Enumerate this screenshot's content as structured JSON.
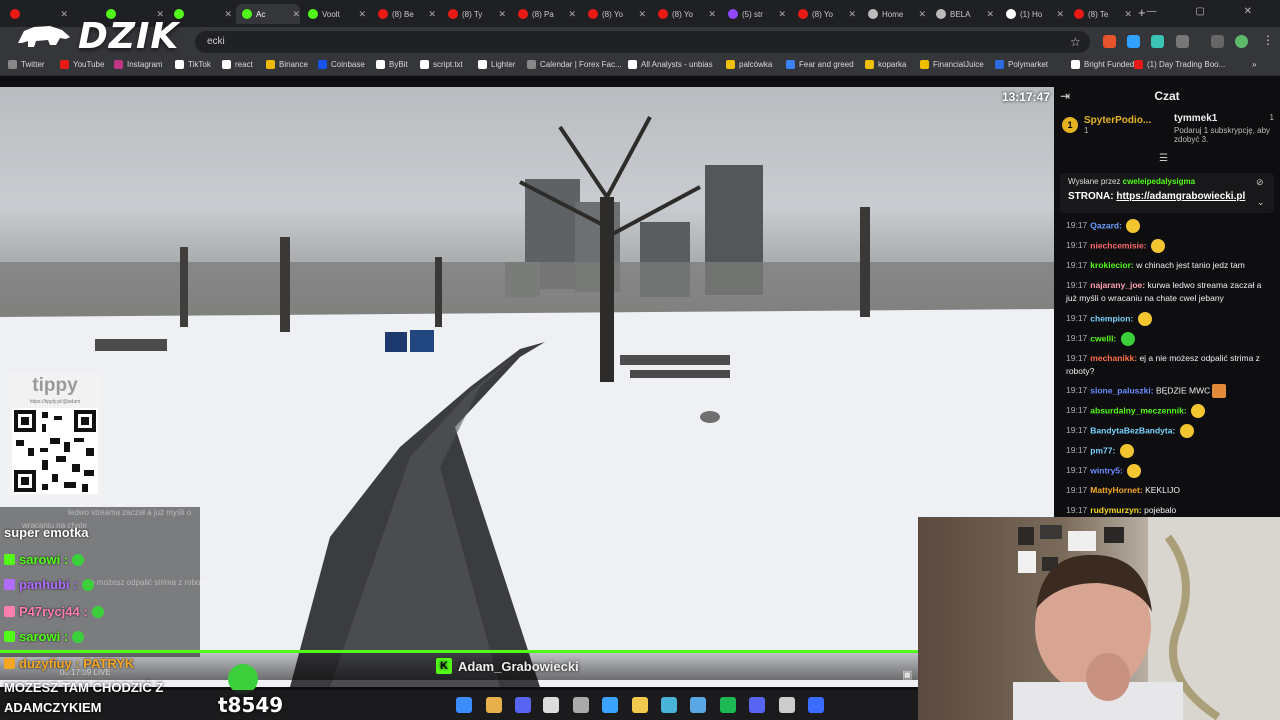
{
  "browser": {
    "tabs": [
      {
        "label": "",
        "color": "#e91916"
      },
      {
        "label": "",
        "color": "#53fc18"
      },
      {
        "label": "",
        "color": "#53fc18"
      },
      {
        "label": "Ac",
        "color": "#53fc18",
        "active": true
      },
      {
        "label": "Voolt",
        "color": "#53fc18"
      },
      {
        "label": "(8) Be",
        "color": "#e91916"
      },
      {
        "label": "(8) Ty",
        "color": "#e91916"
      },
      {
        "label": "(8) Pa",
        "color": "#e91916"
      },
      {
        "label": "(8) Yo",
        "color": "#e91916"
      },
      {
        "label": "(8) Yo",
        "color": "#e91916"
      },
      {
        "label": "(5) str",
        "color": "#9146ff"
      },
      {
        "label": "(8) Yo",
        "color": "#e91916"
      },
      {
        "label": "Home",
        "color": "#bbbbbb"
      },
      {
        "label": "BELA",
        "color": "#bbbbbb"
      },
      {
        "label": "(1) Ho",
        "color": "#ffffff"
      },
      {
        "label": "(8) Te",
        "color": "#e91916"
      }
    ],
    "new_tab": "+",
    "omnibox_text": "ecki",
    "bookmarks": [
      {
        "label": "Twitter",
        "color": "#888888"
      },
      {
        "label": "YouTube",
        "color": "#e91916"
      },
      {
        "label": "Instagram",
        "color": "#c13584"
      },
      {
        "label": "TikTok",
        "color": "#ffffff"
      },
      {
        "label": "react",
        "color": "#ffffff"
      },
      {
        "label": "Binance",
        "color": "#f0b90b"
      },
      {
        "label": "Coinbase",
        "color": "#1652f0"
      },
      {
        "label": "ByBit",
        "color": "#ffffff"
      },
      {
        "label": "script.txt",
        "color": "#ffffff"
      },
      {
        "label": "Lighter",
        "color": "#ffffff"
      },
      {
        "label": "Calendar | Forex Fac...",
        "color": "#888888"
      },
      {
        "label": "All Analysts - unbias",
        "color": "#ffffff"
      },
      {
        "label": "palcówka",
        "color": "#f0c000"
      },
      {
        "label": "Fear and greed",
        "color": "#3b82f6"
      },
      {
        "label": "koparka",
        "color": "#f0c000"
      },
      {
        "label": "FinancialJuice",
        "color": "#f0c000"
      },
      {
        "label": "Polymarket",
        "color": "#2d6cdf"
      },
      {
        "label": "Bright Funded",
        "color": "#ffffff"
      },
      {
        "label": "(1) Day Trading Boo...",
        "color": "#e91916"
      }
    ],
    "more": "»"
  },
  "logo": {
    "text": "DZIK"
  },
  "stream": {
    "clock": "13:17:47",
    "tippy": {
      "title": "tippy",
      "url": "https://tipply.pl/@adam"
    },
    "overlay_chat": [
      {
        "text": "super emotka",
        "color": "#ffffff"
      },
      {
        "text": "sarowi :",
        "color": "#53fc18"
      },
      {
        "text": "panhubi :",
        "color": "#b06cff"
      },
      {
        "text": "P47rycj44 :",
        "color": "#ff7fb0"
      },
      {
        "text": "sarowi :",
        "color": "#53fc18"
      },
      {
        "text": "duzyfiuy : PATRYK",
        "color": "#f5a623"
      }
    ],
    "ghost_lines": [
      "ledwo streama zaczał a już myśli o",
      "wracaniu na chate",
      "nie możesz odpalić strima z roboty?"
    ],
    "streamer_name": "Adam_Grabowiecki",
    "live_time": "00:17:09",
    "live_label": "LIVE",
    "marquee": "MOZESZ TAM CHODZIĆ Z ADAMCZYKIEM",
    "counter": "t8549"
  },
  "chat": {
    "title": "Czat",
    "leaderboard": [
      {
        "rank": "1",
        "name": "SpyterPodio...",
        "count": "1"
      },
      {
        "name": "tymmek1",
        "count": "1",
        "sub": "Podaruj 1 subskrypcję, aby zdobyć 3."
      }
    ],
    "pinned": {
      "by_label": "Wysłane przez",
      "by_user": "cweleipedalysigma",
      "text_prefix": "STRONA: ",
      "link": "https://adamgrabowiecki.pl"
    },
    "messages": [
      {
        "time": "19:17",
        "user": "Qazard:",
        "color": "#6aa0ff",
        "text": ""
      },
      {
        "time": "19:17",
        "user": "niechcemisie:",
        "color": "#ff6b6b",
        "text": ""
      },
      {
        "time": "19:17",
        "user": "krokiecior:",
        "color": "#53fc18",
        "text": "w chinach jest tanio jedz tam"
      },
      {
        "time": "19:17",
        "user": "najarany_joe:",
        "color": "#ff9fb0",
        "text": "kurwa ledwo streama zaczał a już myśli o wracaniu na chate cwel jebany"
      },
      {
        "time": "19:17",
        "user": "chempion:",
        "color": "#7bd3ff",
        "text": ""
      },
      {
        "time": "19:17",
        "user": "cwelll:",
        "color": "#53fc18",
        "text": ""
      },
      {
        "time": "19:17",
        "user": "mechanikk:",
        "color": "#ff7043",
        "text": "ej a nie możesz odpalić strima z roboty?"
      },
      {
        "time": "19:17",
        "user": "slone_paluszki:",
        "color": "#6a8cff",
        "text": "BĘDZIE MWC"
      },
      {
        "time": "19:17",
        "user": "absurdalny_meczennik:",
        "color": "#53fc18",
        "text": ""
      },
      {
        "time": "19:17",
        "user": "BandytaBezBandyta:",
        "color": "#7bd3ff",
        "text": ""
      },
      {
        "time": "19:17",
        "user": "pm77:",
        "color": "#7bd3ff",
        "text": ""
      },
      {
        "time": "19:17",
        "user": "wintry5:",
        "color": "#6a8cff",
        "text": ""
      },
      {
        "time": "19:17",
        "user": "MattyHornet:",
        "color": "#f5a623",
        "text": "KEKLIJO"
      },
      {
        "time": "19:17",
        "user": "rudymurzyn:",
        "color": "#f5d623",
        "text": "pojebalo"
      }
    ]
  }
}
